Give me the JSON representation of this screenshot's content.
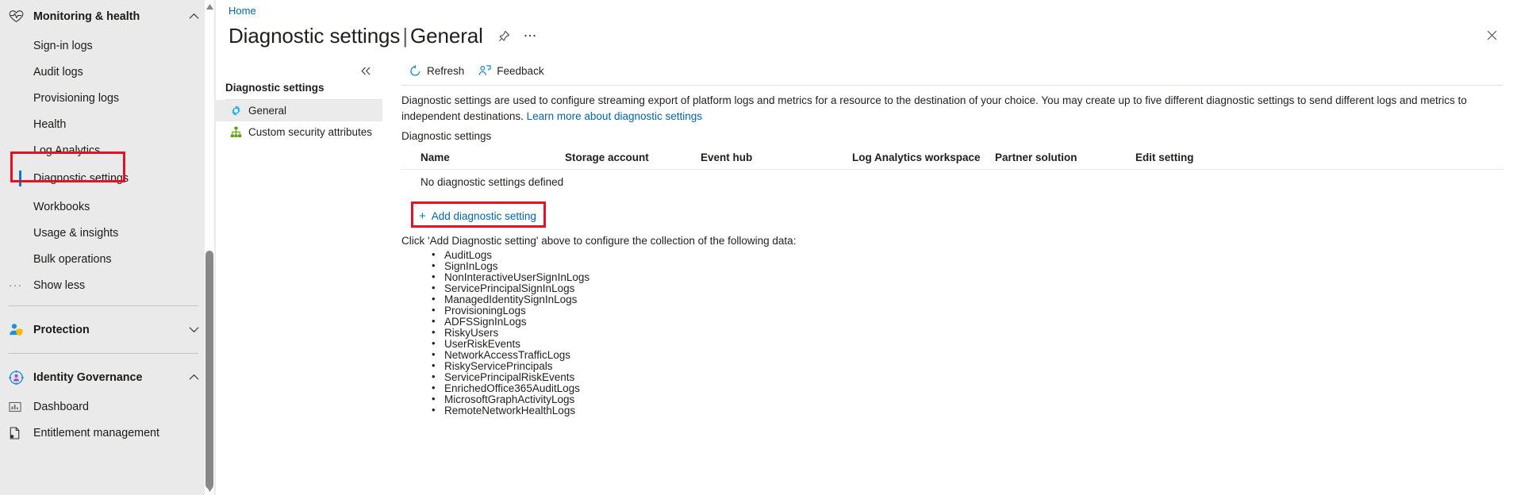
{
  "sidebar": {
    "groups_and_items": [
      {
        "type": "group",
        "label": "Monitoring & health",
        "icon": "heartbeat-icon",
        "chevron": "chevron-up-icon"
      },
      {
        "type": "item",
        "label": "Sign-in logs",
        "icon": ""
      },
      {
        "type": "item",
        "label": "Audit logs",
        "icon": ""
      },
      {
        "type": "item",
        "label": "Provisioning logs",
        "icon": ""
      },
      {
        "type": "item",
        "label": "Health",
        "icon": ""
      },
      {
        "type": "item",
        "label": "Log Analytics",
        "icon": ""
      },
      {
        "type": "item",
        "label": "Diagnostic settings",
        "icon": "",
        "selected": true
      },
      {
        "type": "item",
        "label": "Workbooks",
        "icon": ""
      },
      {
        "type": "item",
        "label": "Usage & insights",
        "icon": ""
      },
      {
        "type": "item",
        "label": "Bulk operations",
        "icon": ""
      },
      {
        "type": "item",
        "label": "Show less",
        "icon": "ellipsis-icon"
      },
      {
        "type": "divider"
      },
      {
        "type": "group",
        "label": "Protection",
        "icon": "user-shield-icon",
        "chevron": "chevron-down-icon"
      },
      {
        "type": "divider"
      },
      {
        "type": "group",
        "label": "Identity Governance",
        "icon": "identity-governance-icon",
        "chevron": "chevron-up-icon"
      },
      {
        "type": "item",
        "label": "Dashboard",
        "icon": "chart-icon"
      },
      {
        "type": "item",
        "label": "Entitlement management",
        "icon": "document-icon"
      }
    ],
    "scrollbar": {
      "up_arrow": "scroll-up-arrow",
      "down_arrow": "scroll-down-arrow"
    }
  },
  "blade": {
    "breadcrumb": "Home",
    "title_main": "Diagnostic settings",
    "title_separator": "|",
    "title_sub": "General",
    "pin_icon": "pin-icon",
    "more_icon": "ellipsis-icon",
    "close_icon": "close-icon"
  },
  "inner_menu": {
    "collapse_icon": "chevron-double-left-icon",
    "heading": "Diagnostic settings",
    "items": [
      {
        "label": "General",
        "icon": "gear-icon",
        "selected": true
      },
      {
        "label": "Custom security attributes",
        "icon": "sitemap-icon",
        "selected": false
      }
    ]
  },
  "command_bar": {
    "buttons": [
      {
        "label": "Refresh",
        "icon": "refresh-icon"
      },
      {
        "label": "Feedback",
        "icon": "feedback-person-icon"
      }
    ]
  },
  "intro": {
    "text_before_link": "Diagnostic settings are used to configure streaming export of platform logs and metrics for a resource to the destination of your choice. You may create up to five different diagnostic settings to send different logs and metrics to independent destinations. ",
    "link_text": "Learn more about diagnostic settings"
  },
  "table": {
    "caption": "Diagnostic settings",
    "columns": [
      "Name",
      "Storage account",
      "Event hub",
      "Log Analytics workspace",
      "Partner solution",
      "Edit setting"
    ],
    "empty_message": "No diagnostic settings defined"
  },
  "add_setting": {
    "plus": "+",
    "label": "Add diagnostic setting"
  },
  "hint": "Click 'Add Diagnostic setting' above to configure the collection of the following data:",
  "log_categories": [
    "AuditLogs",
    "SignInLogs",
    "NonInteractiveUserSignInLogs",
    "ServicePrincipalSignInLogs",
    "ManagedIdentitySignInLogs",
    "ProvisioningLogs",
    "ADFSSignInLogs",
    "RiskyUsers",
    "UserRiskEvents",
    "NetworkAccessTrafficLogs",
    "RiskyServicePrincipals",
    "ServicePrincipalRiskEvents",
    "EnrichedOffice365AuditLogs",
    "MicrosoftGraphActivityLogs",
    "RemoteNetworkHealthLogs"
  ],
  "annotations": {
    "highlight_color": "#e81123",
    "boxes": [
      {
        "name": "sidebar-diagnostic-settings-highlight"
      },
      {
        "name": "edit-setting-column-highlight"
      },
      {
        "name": "add-diagnostic-setting-highlight"
      }
    ]
  },
  "colors": {
    "accent": "#0078d4",
    "link": "#0063b1",
    "sidebar_bg": "#eaeaea",
    "text": "#201f1e",
    "highlight_red": "#e81123"
  }
}
